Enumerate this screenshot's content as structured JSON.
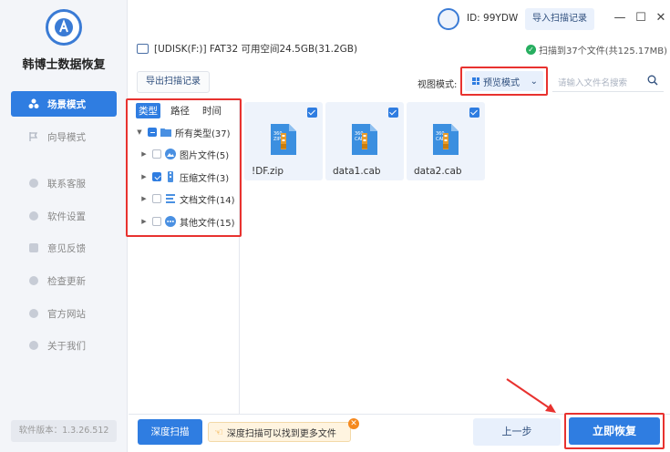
{
  "app": {
    "name": "韩博士数据恢复",
    "version": "软件版本：1.3.26.512"
  },
  "sidebar": {
    "items": [
      {
        "label": "场景模式",
        "icon": "scene-icon"
      },
      {
        "label": "向导模式",
        "icon": "flag-icon"
      },
      {
        "label": "联系客服",
        "icon": "headset-icon"
      },
      {
        "label": "软件设置",
        "icon": "gear-icon"
      },
      {
        "label": "意见反馈",
        "icon": "feedback-icon"
      },
      {
        "label": "检查更新",
        "icon": "refresh-icon"
      },
      {
        "label": "官方网站",
        "icon": "globe-icon"
      },
      {
        "label": "关于我们",
        "icon": "handshake-icon"
      }
    ]
  },
  "header": {
    "user_id": "ID: 99YDW",
    "import_label": "导入扫描记录",
    "drive_info": "[UDISK(F:)] FAT32 可用空间24.5GB(31.2GB)",
    "scan_status": "扫描到37个文件(共125.17MB)",
    "export_label": "导出扫描记录",
    "view_label": "视图模式:",
    "view_mode": "预览模式",
    "search_placeholder": "请输入文件名搜索"
  },
  "tree": {
    "tabs": [
      "类型",
      "路径",
      "时间"
    ],
    "root": "所有类型(37)",
    "items": [
      {
        "label": "图片文件(5)",
        "checked": false
      },
      {
        "label": "压缩文件(3)",
        "checked": true
      },
      {
        "label": "文档文件(14)",
        "checked": false
      },
      {
        "label": "其他文件(15)",
        "checked": false
      }
    ]
  },
  "files": [
    {
      "name": "!DF.zip"
    },
    {
      "name": "data1.cab"
    },
    {
      "name": "data2.cab"
    }
  ],
  "footer": {
    "deep_scan": "深度扫描",
    "tip": "深度扫描可以找到更多文件",
    "prev": "上一步",
    "recover": "立即恢复"
  },
  "colors": {
    "accent": "#2f7de1",
    "highlight": "#e8322f"
  }
}
